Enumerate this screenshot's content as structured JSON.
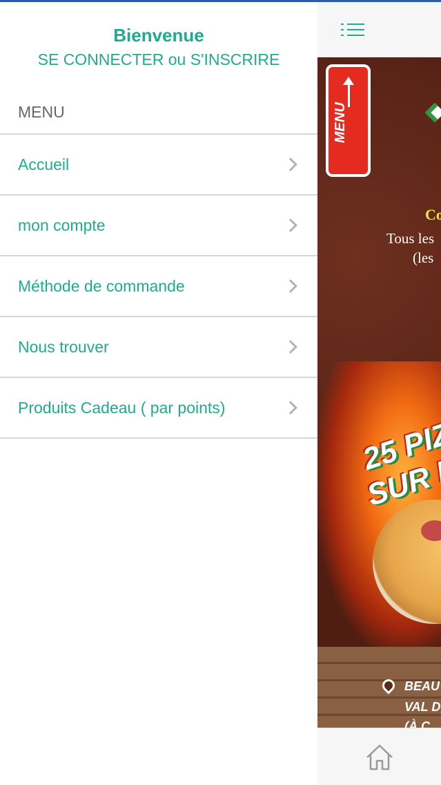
{
  "drawer": {
    "welcome": "Bienvenue",
    "login_link": "SE CONNECTER ou S'INSCRIRE",
    "menu_heading": "MENU",
    "items": [
      {
        "label": "Accueil"
      },
      {
        "label": "mon compte"
      },
      {
        "label": "Méthode de commande"
      },
      {
        "label": "Nous trouver"
      },
      {
        "label": "Produits Cadeau ( par points)"
      }
    ]
  },
  "app": {
    "menu_button_icon": "hamburger-icon",
    "home_icon": "home-icon",
    "banner": {
      "badge_text": "MENU",
      "yellow_text": "Co",
      "line1": "Tous les",
      "line2": "(les",
      "promo_line1": "25 PIZ",
      "promo_line2": "SUR PL",
      "address_line1": "BEAU",
      "address_line2": "VAL D",
      "address_line3": "(À C"
    }
  },
  "colors": {
    "accent": "#20ab8e",
    "divider": "#d6d6d6",
    "heading_gray": "#666666",
    "badge_red": "#e52a20"
  }
}
